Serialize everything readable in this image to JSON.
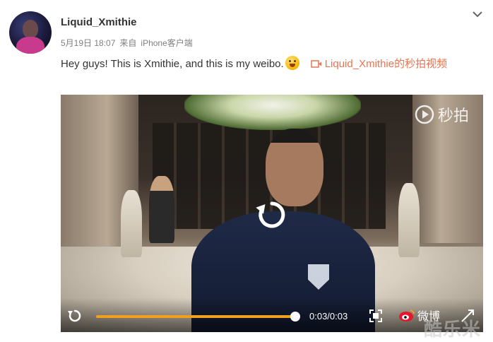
{
  "post": {
    "username": "Liquid_Xmithie",
    "date": "5月19日 18:07",
    "source_prefix": "来自",
    "source": "iPhone客户端",
    "text": "Hey guys! This is Xmithie, and this is my weibo.",
    "emoji": "laughing-emoji",
    "video_link": "Liquid_Xmithie的秒拍视频"
  },
  "video": {
    "watermark": "秒拍",
    "time": "0:03/0:03",
    "progress": 1.0,
    "weibo_brand": "微博"
  },
  "corner_watermark": "酷乐米",
  "colors": {
    "accent": "#eb7350",
    "progress": "#f0a020",
    "text": "#333333",
    "meta": "#808080"
  }
}
